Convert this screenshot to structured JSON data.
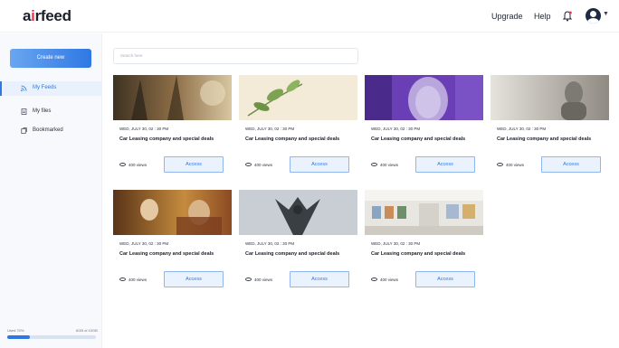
{
  "header": {
    "logo": "airfeed",
    "upgrade": "Upgrade",
    "help": "Help",
    "bell_icon": "bell-icon",
    "avatar_icon": "avatar-icon"
  },
  "sidebar": {
    "create_button": "Create new",
    "items": [
      {
        "label": "My Feeds",
        "icon": "rss-icon",
        "active": true
      },
      {
        "label": "My files",
        "icon": "file-icon",
        "active": false
      },
      {
        "label": "Bookmarked",
        "icon": "bookmark-icon",
        "active": false
      }
    ],
    "storage": {
      "used_label": "Used 70%",
      "capacity_label": "6GB of 10GB",
      "used_fraction": 0.25
    }
  },
  "search": {
    "placeholder": "Search here"
  },
  "colors": {
    "accent": "#2f78e4",
    "accent_light": "#eaf2fd"
  },
  "cards": [
    {
      "date": "WED, JULY 30, 02 : 30 PM",
      "title": "Car Leasing company and special deals",
      "views": "400 views",
      "access": "Access",
      "image": "forest-painting"
    },
    {
      "date": "WED, JULY 30, 02 : 30 PM",
      "title": "Car Leasing company and special deals",
      "views": "400 views",
      "access": "Access",
      "image": "plant-leaves"
    },
    {
      "date": "WED, JULY 30, 02 : 30 PM",
      "title": "Car Leasing company and special deals",
      "views": "400 views",
      "access": "Access",
      "image": "purple-statue"
    },
    {
      "date": "WED, JULY 30, 02 : 30 PM",
      "title": "Car Leasing company and special deals",
      "views": "400 views",
      "access": "Access",
      "image": "buddha-statue"
    },
    {
      "date": "WED, JULY 30, 02 : 30 PM",
      "title": "Car Leasing company and special deals",
      "views": "400 views",
      "access": "Access",
      "image": "classical-painting"
    },
    {
      "date": "WED, JULY 30, 02 : 30 PM",
      "title": "Car Leasing company and special deals",
      "views": "400 views",
      "access": "Access",
      "image": "gargoyle-statue"
    },
    {
      "date": "WED, JULY 30, 02 : 30 PM",
      "title": "Car Leasing company and special deals",
      "views": "400 views",
      "access": "Access",
      "image": "gallery-interior"
    }
  ]
}
